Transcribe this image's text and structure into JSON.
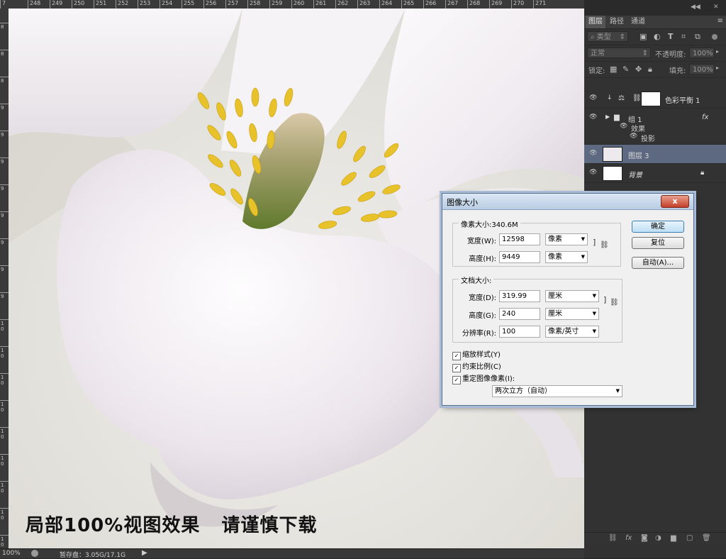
{
  "ruler": {
    "top_ticks": [
      "7",
      "248",
      "249",
      "250",
      "251",
      "252",
      "253",
      "254",
      "255",
      "256",
      "257",
      "258",
      "259",
      "260",
      "261",
      "262",
      "263",
      "264",
      "265",
      "266",
      "267",
      "268",
      "269",
      "270",
      "271"
    ],
    "left_ticks": [
      "8",
      "8",
      "8",
      "9",
      "9",
      "9",
      "9",
      "9",
      "9",
      "9",
      "9",
      "1 0",
      "1 0",
      "1 0",
      "1 0",
      "1 0",
      "1 0",
      "1 0",
      "1 0",
      "1 0"
    ]
  },
  "canvas": {
    "caption": "局部100%视图效果   请谨慎下载"
  },
  "status": {
    "zoom": "100%",
    "scratch": "暂存盘：3.05G/17.1G",
    "arrow": "▶"
  },
  "panel": {
    "top_strip": {
      "collapse": "◀◀",
      "close": "✕"
    },
    "tabs": [
      "图层",
      "路径",
      "通道"
    ],
    "menu_icon": "≡",
    "filter_label": "类型",
    "filter_icons": [
      "image-filter-icon",
      "adjustment-filter-icon",
      "type-filter-icon",
      "shape-filter-icon",
      "smart-filter-icon"
    ],
    "blend_mode": "正常",
    "opacity_label": "不透明度:",
    "opacity_value": "100%",
    "lock_label": "锁定:",
    "fill_label": "填充:",
    "fill_value": "100%",
    "layers": [
      {
        "name": "色彩平衡 1",
        "type": "adjustment"
      },
      {
        "name": "组 1",
        "type": "group",
        "fx": "fx",
        "effects_label": "效果",
        "effect_item": "投影"
      },
      {
        "name": "图层 3",
        "type": "pixel",
        "selected": true
      },
      {
        "name": "背景",
        "type": "background"
      }
    ],
    "bottom_icons": [
      "link-icon",
      "fx-icon",
      "mask-icon",
      "adjustment-icon",
      "folder-icon",
      "new-layer-icon",
      "trash-icon"
    ]
  },
  "dialog": {
    "title": "图像大小",
    "close": "x",
    "pixel_dimensions": {
      "legend": "像素大小:340.6M",
      "width_label": "宽度(W):",
      "width_value": "12598",
      "width_unit": "像素",
      "height_label": "高度(H):",
      "height_value": "9449",
      "height_unit": "像素"
    },
    "document_size": {
      "legend": "文档大小:",
      "width_label": "宽度(D):",
      "width_value": "319.99",
      "width_unit": "厘米",
      "height_label": "高度(G):",
      "height_value": "240",
      "height_unit": "厘米",
      "resolution_label": "分辨率(R):",
      "resolution_value": "100",
      "resolution_unit": "像素/英寸"
    },
    "checkboxes": {
      "scale_styles": "缩放样式(Y)",
      "constrain": "约束比例(C)",
      "resample": "重定图像像素(I):"
    },
    "resample_method": "两次立方（自动）",
    "buttons": {
      "ok": "确定",
      "reset": "复位",
      "auto": "自动(A)..."
    }
  }
}
